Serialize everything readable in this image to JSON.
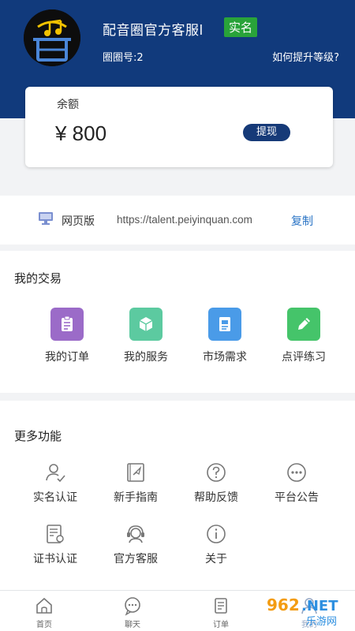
{
  "header": {
    "user_name": "配音圈官方客服l",
    "verified_badge": "实名",
    "user_id": "圈圈号:2",
    "level_link": "如何提升等级?"
  },
  "balance": {
    "label": "余额",
    "amount": "¥ 800",
    "withdraw_button": "提现"
  },
  "web_version": {
    "label": "网页版",
    "url": "https://talent.peiyinquan.com",
    "copy_label": "复制"
  },
  "my_trades": {
    "title": "我的交易",
    "items": [
      {
        "label": "我的订单",
        "icon": "clipboard-icon",
        "color": "#9b6bc8"
      },
      {
        "label": "我的服务",
        "icon": "cube-icon",
        "color": "#5ccaa0"
      },
      {
        "label": "市场需求",
        "icon": "document-icon",
        "color": "#4a9be8"
      },
      {
        "label": "点评练习",
        "icon": "pencil-icon",
        "color": "#45c46a"
      }
    ]
  },
  "more_features": {
    "title": "更多功能",
    "items": [
      {
        "label": "实名认证",
        "icon": "user-check-icon"
      },
      {
        "label": "新手指南",
        "icon": "guide-book-icon"
      },
      {
        "label": "帮助反馈",
        "icon": "question-circle-icon"
      },
      {
        "label": "平台公告",
        "icon": "more-dots-icon"
      },
      {
        "label": "证书认证",
        "icon": "certificate-icon"
      },
      {
        "label": "官方客服",
        "icon": "headset-icon"
      },
      {
        "label": "关于",
        "icon": "info-circle-icon"
      }
    ]
  },
  "tabbar": {
    "tabs": [
      {
        "label": "首页",
        "icon": "home-icon"
      },
      {
        "label": "聊天",
        "icon": "chat-icon"
      },
      {
        "label": "订单",
        "icon": "order-icon"
      },
      {
        "label": "我的",
        "icon": "profile-icon"
      }
    ]
  },
  "watermark": {
    "text_main": "962.NET",
    "text_sub": "乐游网"
  },
  "colors": {
    "header_bg": "#113a7c",
    "verified_green": "#29a33a",
    "link_blue": "#2a74c5"
  }
}
